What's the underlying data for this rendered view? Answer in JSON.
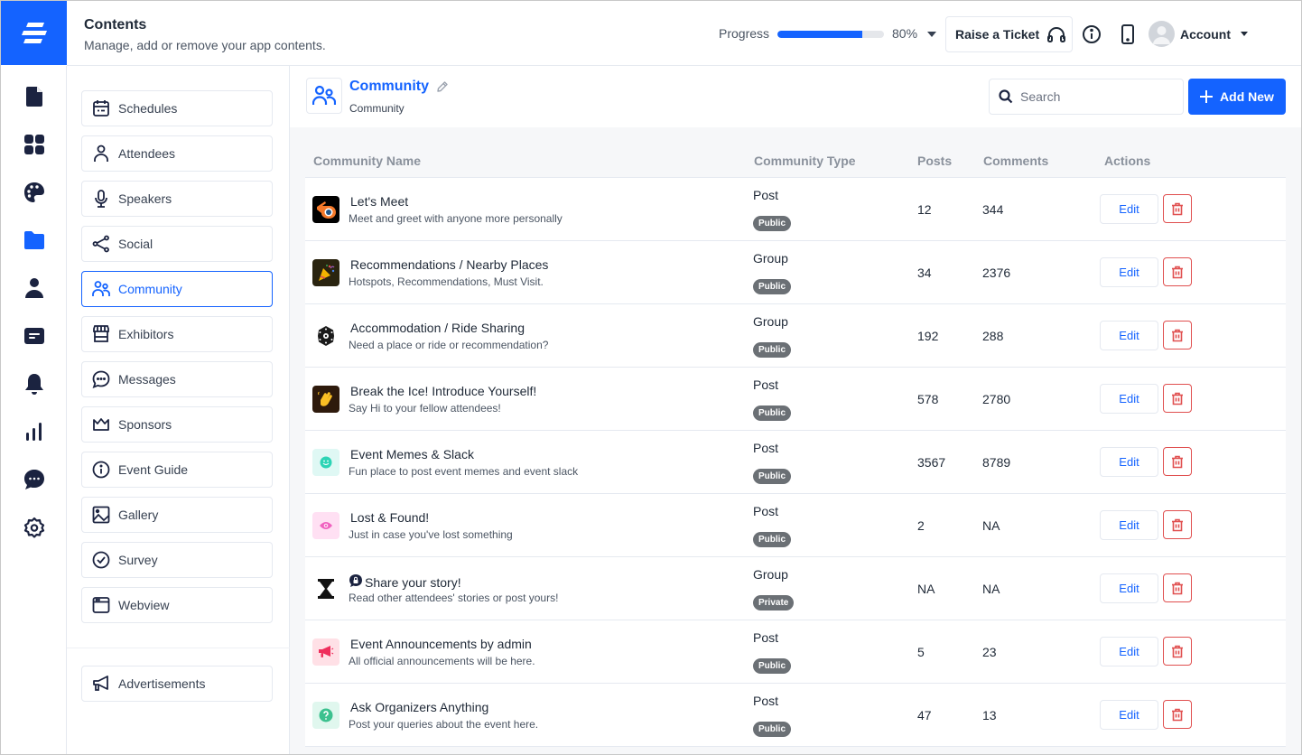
{
  "header": {
    "logo_icon": "brand-logo-icon",
    "title": "Contents",
    "subtitle": "Manage, add or remove your app contents.",
    "progress_label": "Progress",
    "progress_value": 0.8,
    "progress_text": "80%",
    "raise_ticket_label": "Raise a Ticket",
    "account_label": "Account"
  },
  "rail": {
    "items": [
      {
        "icon": "document-icon",
        "active": false
      },
      {
        "icon": "grid-icon",
        "active": false
      },
      {
        "icon": "palette-icon",
        "active": false
      },
      {
        "icon": "folder-icon",
        "active": true
      },
      {
        "icon": "user-icon",
        "active": false
      },
      {
        "icon": "card-icon",
        "active": false
      },
      {
        "icon": "bell-icon",
        "active": false
      },
      {
        "icon": "bar-chart-icon",
        "active": false
      },
      {
        "icon": "chat-icon",
        "active": false
      },
      {
        "icon": "settings-icon",
        "active": false
      }
    ]
  },
  "sidebar": {
    "items": [
      {
        "label": "Schedules",
        "icon": "calendar-icon"
      },
      {
        "label": "Attendees",
        "icon": "person-icon"
      },
      {
        "label": "Speakers",
        "icon": "microphone-icon"
      },
      {
        "label": "Social",
        "icon": "share-icon"
      },
      {
        "label": "Community",
        "icon": "users-icon",
        "active": true
      },
      {
        "label": "Exhibitors",
        "icon": "store-icon"
      },
      {
        "label": "Messages",
        "icon": "message-icon"
      },
      {
        "label": "Sponsors",
        "icon": "crown-icon"
      },
      {
        "label": "Event Guide",
        "icon": "info-icon"
      },
      {
        "label": "Gallery",
        "icon": "image-icon"
      },
      {
        "label": "Survey",
        "icon": "check-circle-icon"
      },
      {
        "label": "Webview",
        "icon": "browser-icon"
      }
    ],
    "bottom_item": {
      "label": "Advertisements",
      "icon": "megaphone-icon"
    }
  },
  "main": {
    "title": "Community",
    "breadcrumb": "Community",
    "search_placeholder": "Search",
    "add_new_label": "Add New",
    "columns": [
      "Community Name",
      "Community Type",
      "Posts",
      "Comments",
      "Actions"
    ],
    "edit_label": "Edit",
    "rows": [
      {
        "name": "Let's Meet",
        "description": "Meet and greet with anyone more personally",
        "type": "Post",
        "visibility": "Public",
        "posts": "12",
        "comments": "344",
        "icon": "blender-logo-icon",
        "icon_bg": "#000000"
      },
      {
        "name": "Recommendations / Nearby Places",
        "description": "Hotspots, Recommendations, Must Visit.",
        "type": "Group",
        "visibility": "Public",
        "posts": "34",
        "comments": "2376",
        "icon": "party-popper-icon",
        "icon_bg": "#2a2410"
      },
      {
        "name": "Accommodation / Ride Sharing",
        "description": "Need a place or ride or recommendation?",
        "type": "Group",
        "visibility": "Public",
        "posts": "192",
        "comments": "288",
        "icon": "atom-icon",
        "icon_bg": "#ffffff"
      },
      {
        "name": "Break the Ice! Introduce Yourself!",
        "description": "Say Hi to your fellow attendees!",
        "type": "Post",
        "visibility": "Public",
        "posts": "578",
        "comments": "2780",
        "icon": "waving-hand-icon",
        "icon_bg": "#2e1a0c"
      },
      {
        "name": "Event Memes & Slack",
        "description": "Fun place to post event memes and event slack",
        "type": "Post",
        "visibility": "Public",
        "posts": "3567",
        "comments": "8789",
        "icon": "smiley-icon",
        "icon_bg": "#dff8f4"
      },
      {
        "name": "Lost & Found!",
        "description": "Just in case you've lost something",
        "type": "Post",
        "visibility": "Public",
        "posts": "2",
        "comments": "NA",
        "icon": "eye-icon",
        "icon_bg": "#ffe0f3"
      },
      {
        "name": "Share your story!",
        "description": "Read other attendees' stories or post yours!",
        "type": "Group",
        "visibility": "Private",
        "posts": "NA",
        "comments": "NA",
        "icon": "hourglass-icon",
        "icon_bg": "#ffffff",
        "locked": true
      },
      {
        "name": "Event Announcements by admin",
        "description": "All official announcements will be here.",
        "type": "Post",
        "visibility": "Public",
        "posts": "5",
        "comments": "23",
        "icon": "megaphone-icon",
        "icon_bg": "#ffe0e6"
      },
      {
        "name": "Ask Organizers Anything",
        "description": "Post your queries about the event here.",
        "type": "Post",
        "visibility": "Public",
        "posts": "47",
        "comments": "13",
        "icon": "question-icon",
        "icon_bg": "#e0f7ee"
      }
    ]
  }
}
